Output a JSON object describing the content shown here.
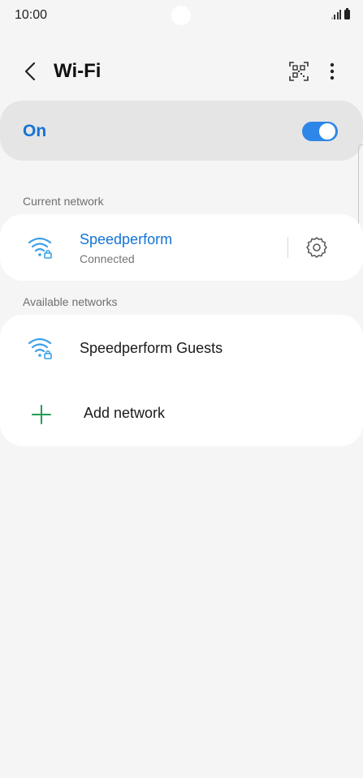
{
  "status_bar": {
    "time": "10:00"
  },
  "header": {
    "title": "Wi-Fi"
  },
  "master_switch": {
    "label": "On",
    "on": true,
    "accent_color": "#1574d4"
  },
  "current_network": {
    "section_label": "Current network",
    "name": "Speedperform",
    "status": "Connected"
  },
  "available_networks": {
    "section_label": "Available networks",
    "items": [
      {
        "name": "Speedperform Guests"
      }
    ],
    "add_label": "Add network"
  },
  "icons": {
    "back": "back-arrow-icon",
    "qr": "qr-code-icon",
    "more": "more-vert-icon",
    "wifi_secured": "wifi-lock-icon",
    "settings": "gear-icon",
    "add": "plus-icon"
  }
}
